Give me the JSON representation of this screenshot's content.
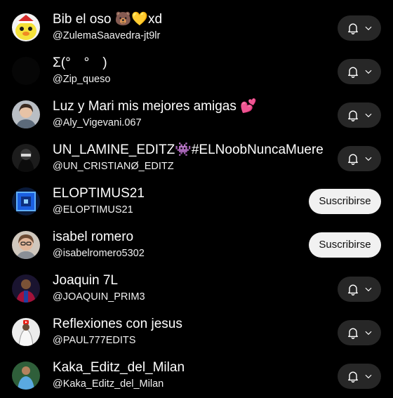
{
  "subscriptions": [
    {
      "name": "Bib el oso 🐻💛xd",
      "handle": "@ZulemaSaavedra-jt9lr",
      "action": "bell"
    },
    {
      "name": "Σ(°　°　)",
      "handle": "@Zip_queso",
      "action": "bell"
    },
    {
      "name": "Luz y Mari mis mejores amigas 💕",
      "handle": "@Aly_Vigevani.067",
      "action": "bell"
    },
    {
      "name": "UN_LAMINE_EDITZ👾#ELNoobNuncaMuere",
      "handle": "@UN_CRISTIANØ_EDITZ",
      "action": "bell"
    },
    {
      "name": "ELOPTIMUS21",
      "handle": "@ELOPTIMUS21",
      "action": "subscribe",
      "button_label": "Suscribirse"
    },
    {
      "name": "isabel romero",
      "handle": "@isabelromero5302",
      "action": "subscribe",
      "button_label": "Suscribirse"
    },
    {
      "name": "Joaquin 7L",
      "handle": "@JOAQUIN_PRIM3",
      "action": "bell"
    },
    {
      "name": "Reflexiones con jesus",
      "handle": "@PAUL777EDITS",
      "action": "bell"
    },
    {
      "name": "Kaka_Editz_del_Milan",
      "handle": "@Kaka_Editz_del_Milan",
      "action": "bell"
    }
  ],
  "icons": {
    "bell": "bell-icon",
    "chevron": "chevron-down-icon"
  },
  "colors": {
    "background": "#000000",
    "bell_button_bg": "#272727",
    "subscribe_button_bg": "#f1f1f1",
    "subscribe_button_text": "#0f0f0f",
    "text_primary": "#ffffff"
  }
}
